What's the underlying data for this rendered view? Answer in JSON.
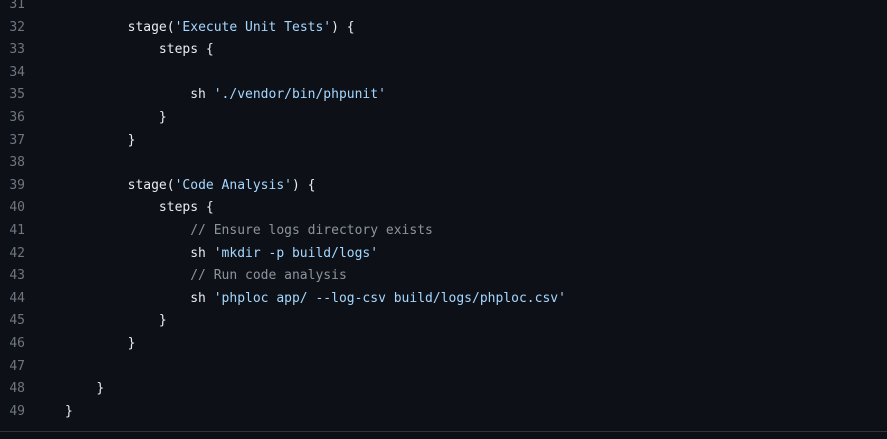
{
  "code": {
    "lines": [
      {
        "number": "31",
        "indent": "",
        "tokens": []
      },
      {
        "number": "32",
        "indent": "        ",
        "tokens": [
          {
            "t": "plain",
            "v": "stage("
          },
          {
            "t": "string",
            "v": "'Execute Unit Tests'"
          },
          {
            "t": "plain",
            "v": ") {"
          }
        ]
      },
      {
        "number": "33",
        "indent": "            ",
        "tokens": [
          {
            "t": "plain",
            "v": "steps {"
          }
        ]
      },
      {
        "number": "34",
        "indent": "",
        "tokens": []
      },
      {
        "number": "35",
        "indent": "                ",
        "tokens": [
          {
            "t": "plain",
            "v": "sh "
          },
          {
            "t": "string",
            "v": "'./vendor/bin/phpunit'"
          }
        ]
      },
      {
        "number": "36",
        "indent": "            ",
        "tokens": [
          {
            "t": "plain",
            "v": "}"
          }
        ]
      },
      {
        "number": "37",
        "indent": "        ",
        "tokens": [
          {
            "t": "plain",
            "v": "}"
          }
        ]
      },
      {
        "number": "38",
        "indent": "",
        "tokens": []
      },
      {
        "number": "39",
        "indent": "        ",
        "tokens": [
          {
            "t": "plain",
            "v": "stage("
          },
          {
            "t": "string",
            "v": "'Code Analysis'"
          },
          {
            "t": "plain",
            "v": ") {"
          }
        ]
      },
      {
        "number": "40",
        "indent": "            ",
        "tokens": [
          {
            "t": "plain",
            "v": "steps {"
          }
        ]
      },
      {
        "number": "41",
        "indent": "                ",
        "tokens": [
          {
            "t": "comment",
            "v": "// Ensure logs directory exists"
          }
        ]
      },
      {
        "number": "42",
        "indent": "                ",
        "tokens": [
          {
            "t": "plain",
            "v": "sh "
          },
          {
            "t": "string",
            "v": "'mkdir -p build/logs'"
          }
        ]
      },
      {
        "number": "43",
        "indent": "                ",
        "tokens": [
          {
            "t": "comment",
            "v": "// Run code analysis"
          }
        ]
      },
      {
        "number": "44",
        "indent": "                ",
        "tokens": [
          {
            "t": "plain",
            "v": "sh "
          },
          {
            "t": "string",
            "v": "'phploc app/ --log-csv build/logs/phploc.csv'"
          }
        ]
      },
      {
        "number": "45",
        "indent": "            ",
        "tokens": [
          {
            "t": "plain",
            "v": "}"
          }
        ]
      },
      {
        "number": "46",
        "indent": "        ",
        "tokens": [
          {
            "t": "plain",
            "v": "}"
          }
        ]
      },
      {
        "number": "47",
        "indent": "",
        "tokens": []
      },
      {
        "number": "48",
        "indent": "    ",
        "tokens": [
          {
            "t": "plain",
            "v": "}"
          }
        ]
      },
      {
        "number": "49",
        "indent": "",
        "tokens": [
          {
            "t": "plain",
            "v": "}"
          }
        ]
      }
    ]
  },
  "colors": {
    "background": "#0d1117",
    "line_number": "#6e7681",
    "text": "#e6edf3",
    "string": "#a5d6ff",
    "comment": "#8b949e",
    "border": "#30363d"
  }
}
